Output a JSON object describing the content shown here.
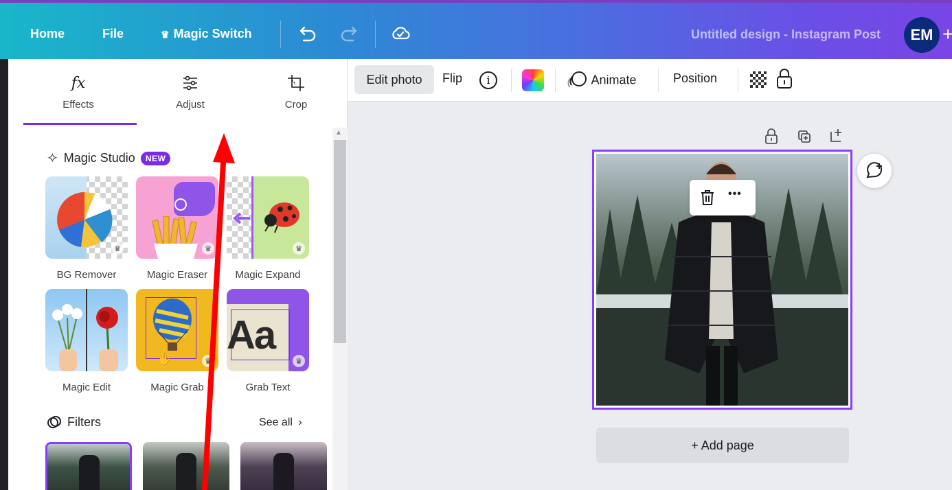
{
  "topbar": {
    "home": "Home",
    "file": "File",
    "magic_switch": "Magic Switch",
    "design_title": "Untitled design - Instagram Post",
    "avatar_initials": "EM",
    "plus": "+"
  },
  "panel": {
    "tabs": [
      {
        "label": "Effects",
        "glyph": "fx"
      },
      {
        "label": "Adjust"
      },
      {
        "label": "Crop"
      }
    ],
    "magic_studio": {
      "title": "Magic Studio",
      "badge": "NEW",
      "tools": [
        {
          "label": "BG Remover"
        },
        {
          "label": "Magic Eraser"
        },
        {
          "label": "Magic Expand"
        },
        {
          "label": "Magic Edit"
        },
        {
          "label": "Magic Grab"
        },
        {
          "label": "Grab Text",
          "tile_text": "Aa"
        }
      ]
    },
    "filters": {
      "title": "Filters",
      "see_all": "See all"
    }
  },
  "toolbar": {
    "edit_photo": "Edit photo",
    "flip": "Flip",
    "animate": "Animate",
    "position": "Position"
  },
  "canvas": {
    "add_page": "+ Add page",
    "more_dots": "•••"
  },
  "colors": {
    "accent": "#7d2ae8",
    "selection": "#8b3dff",
    "annotation_arrow": "#ff0000"
  }
}
